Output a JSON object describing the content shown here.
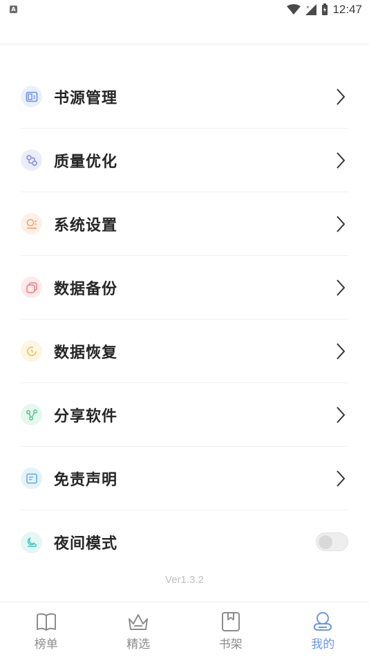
{
  "status_bar": {
    "time": "12:47",
    "app_badge": "A"
  },
  "menu": [
    {
      "label": "书源管理",
      "icon": "book-source-icon",
      "color": "#6c8ff0",
      "bg": "#eaf0fd"
    },
    {
      "label": "质量优化",
      "icon": "quality-icon",
      "color": "#7a86e6",
      "bg": "#ecedfb"
    },
    {
      "label": "系统设置",
      "icon": "settings-icon",
      "color": "#f0a367",
      "bg": "#fdf1e7"
    },
    {
      "label": "数据备份",
      "icon": "backup-icon",
      "color": "#ec7b7b",
      "bg": "#fdeaea"
    },
    {
      "label": "数据恢复",
      "icon": "restore-icon",
      "color": "#e9c24f",
      "bg": "#fcf6e2"
    },
    {
      "label": "分享软件",
      "icon": "share-icon",
      "color": "#4fc58a",
      "bg": "#e6f7ee"
    },
    {
      "label": "免责声明",
      "icon": "disclaimer-icon",
      "color": "#5aa8e6",
      "bg": "#e6f2fb"
    },
    {
      "label": "夜间模式",
      "icon": "night-mode-icon",
      "color": "#45c6bd",
      "bg": "#e3f7f5",
      "toggle": false
    }
  ],
  "version": "Ver1.3.2",
  "tabs": [
    {
      "label": "榜单",
      "icon": "ranking-icon"
    },
    {
      "label": "精选",
      "icon": "crown-icon"
    },
    {
      "label": "书架",
      "icon": "bookshelf-icon"
    },
    {
      "label": "我的",
      "icon": "profile-icon",
      "active": true
    }
  ]
}
